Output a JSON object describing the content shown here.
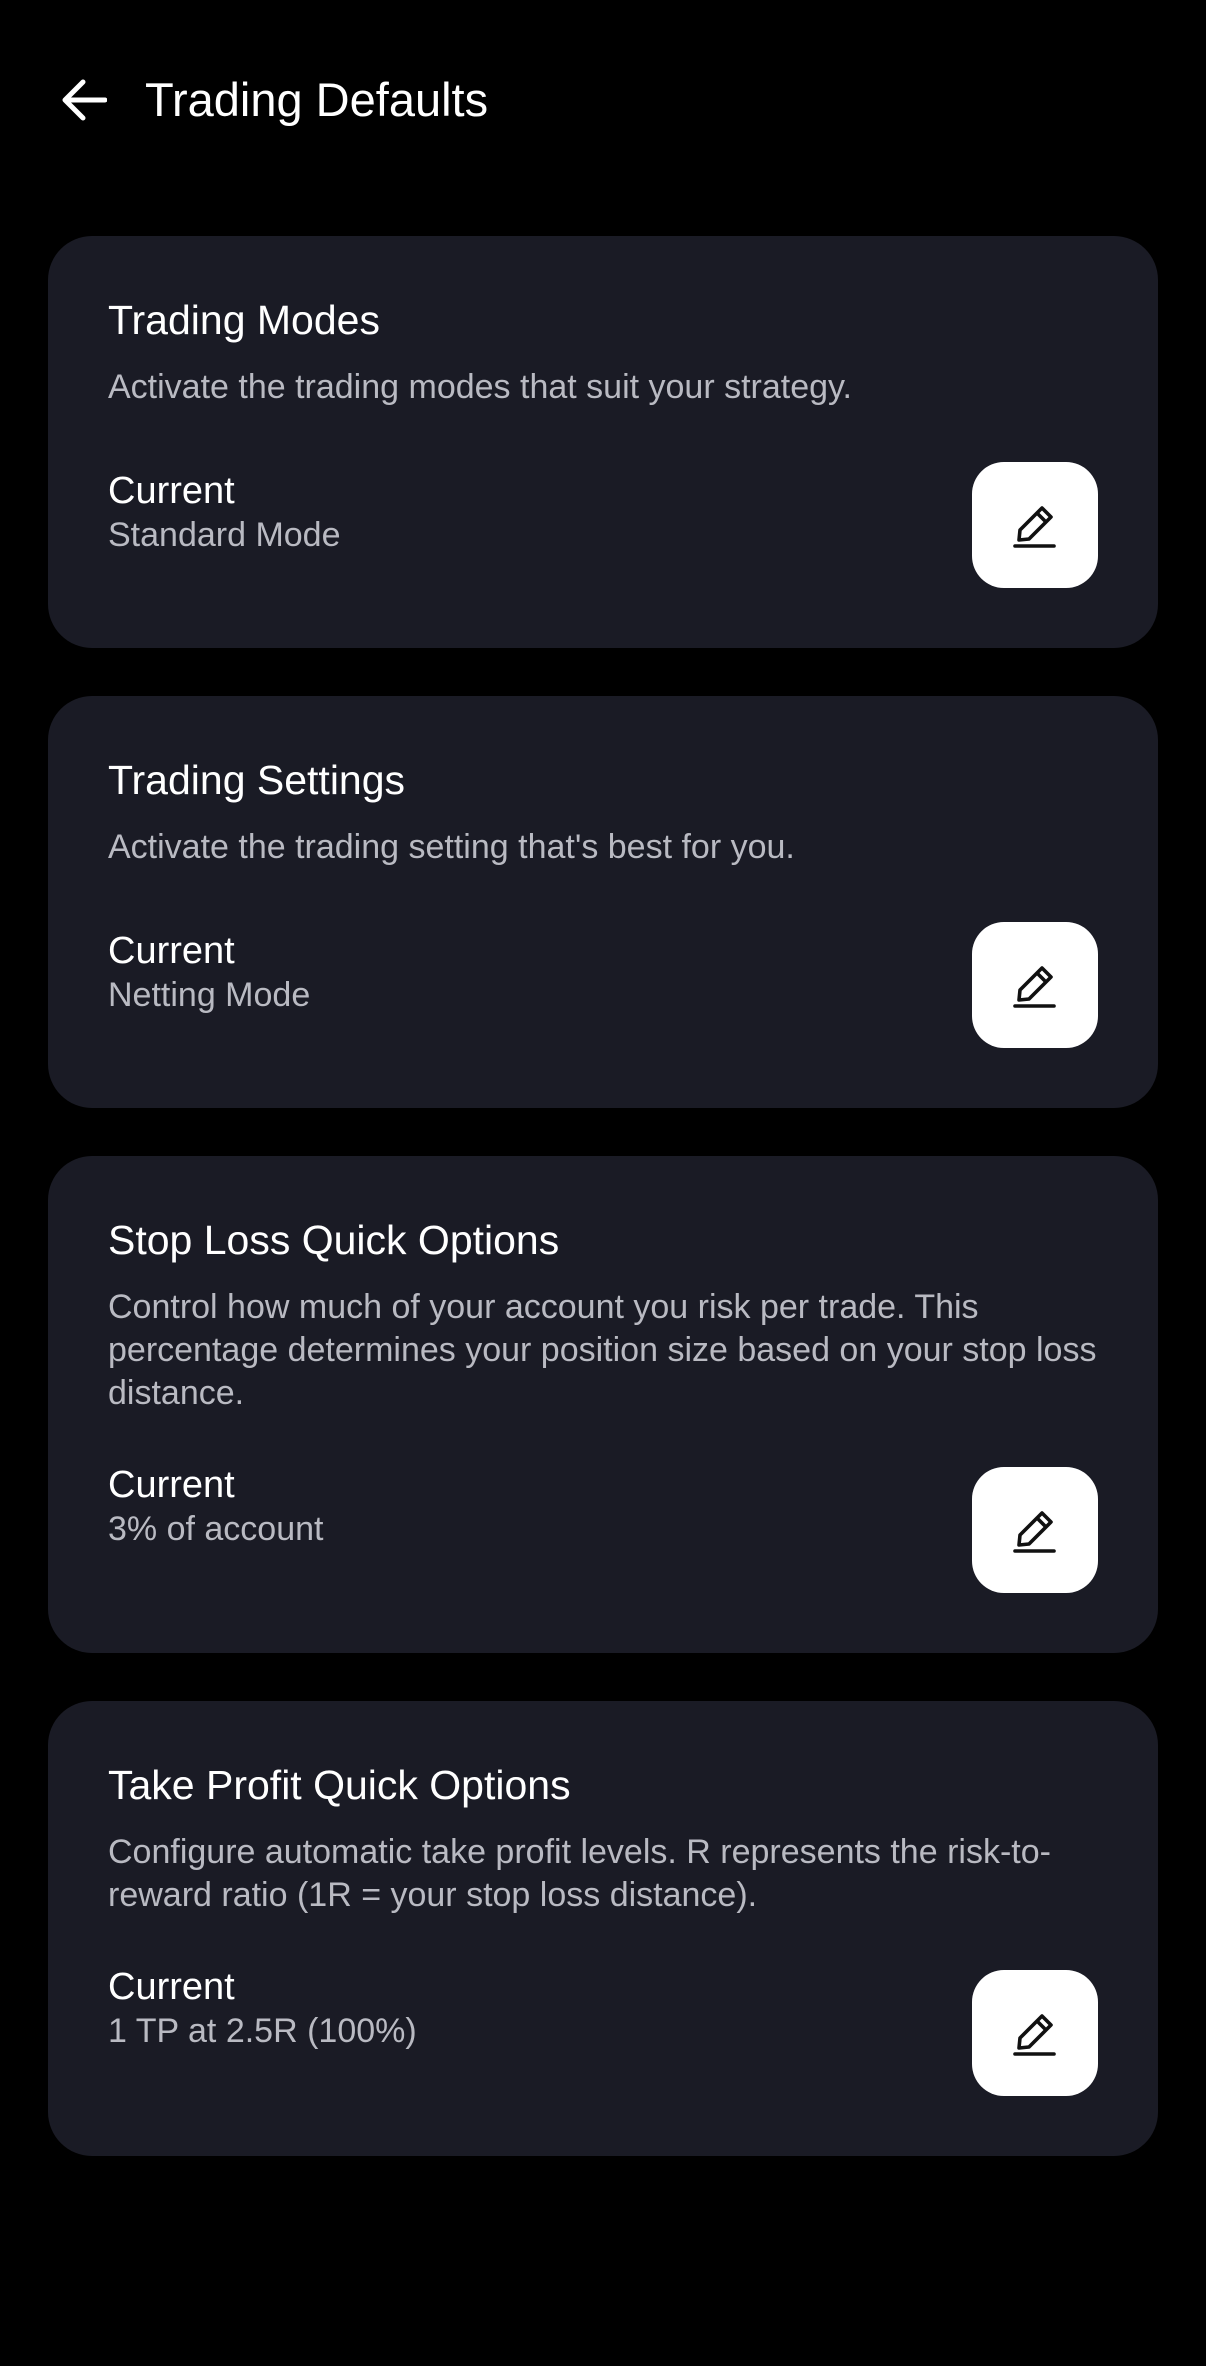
{
  "header": {
    "title": "Trading Defaults",
    "back_icon": "arrow-left-icon"
  },
  "cards": [
    {
      "title": "Trading Modes",
      "description": "Activate the trading modes that suit your strategy.",
      "current_label": "Current",
      "current_value": "Standard Mode",
      "edit_icon": "pencil-icon"
    },
    {
      "title": "Trading Settings",
      "description": "Activate the trading setting that's best for you.",
      "current_label": "Current",
      "current_value": "Netting Mode",
      "edit_icon": "pencil-icon"
    },
    {
      "title": "Stop Loss Quick Options",
      "description": "Control how much of your account you risk per trade. This percentage determines your position size based on your stop loss distance.",
      "current_label": "Current",
      "current_value": "3% of account",
      "edit_icon": "pencil-icon"
    },
    {
      "title": "Take Profit Quick Options",
      "description": "Configure automatic take profit levels. R represents the risk-to-reward ratio (1R = your stop loss distance).",
      "current_label": "Current",
      "current_value": "1 TP at 2.5R (100%)",
      "edit_icon": "pencil-icon"
    }
  ],
  "colors": {
    "background": "#000000",
    "card": "#1a1b25",
    "text_primary": "#ffffff",
    "text_secondary": "#b9bac2",
    "button": "#ffffff"
  }
}
